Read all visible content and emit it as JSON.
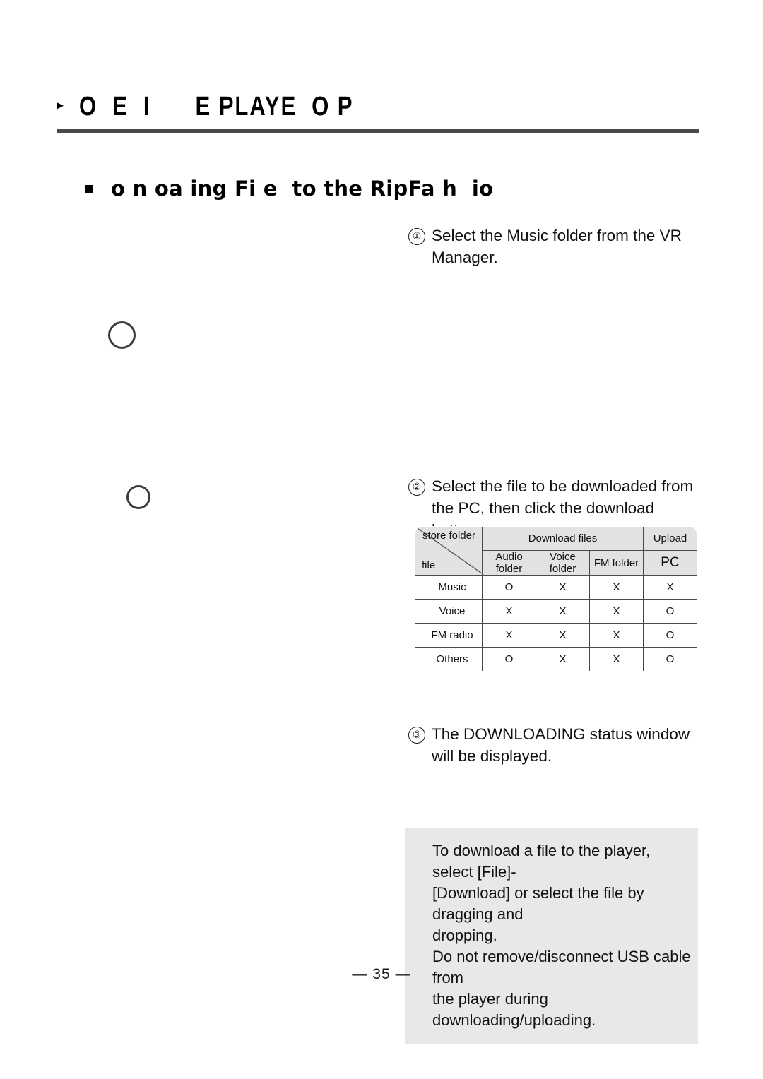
{
  "header": {
    "caret_icon": "triangle-right-icon",
    "title": "O  E  I      E PLAYE  O P"
  },
  "subtitle": {
    "bullet_icon": "square-bullet-icon",
    "text": "o n oa ing Fi e  to the RipFa h  io"
  },
  "steps": [
    {
      "number": "①",
      "text": "Select the Music folder from the VR Manager."
    },
    {
      "number": "②",
      "text": "Select the file to be downloaded from the PC, then click the download button."
    },
    {
      "number": "③",
      "text": "The DOWNLOADING status window will be displayed."
    }
  ],
  "table": {
    "corner": {
      "top_label": "store folder",
      "bottom_label": "file"
    },
    "group_headers": [
      {
        "label": "Download files",
        "span": 3
      },
      {
        "label": "Upload",
        "span": 1
      }
    ],
    "column_headers": [
      "Audio folder",
      "Voice folder",
      "FM folder",
      "PC"
    ],
    "rows": [
      {
        "label": "Music",
        "cells": [
          "O",
          "X",
          "X",
          "X"
        ]
      },
      {
        "label": "Voice",
        "cells": [
          "X",
          "X",
          "X",
          "O"
        ]
      },
      {
        "label": "FM radio",
        "cells": [
          "X",
          "X",
          "X",
          "O"
        ]
      },
      {
        "label": "Others",
        "cells": [
          "O",
          "X",
          "X",
          "O"
        ]
      }
    ]
  },
  "note": {
    "lines": [
      "To download a file to the player, select [File]-",
      "[Download] or select the file by dragging and",
      "dropping.",
      "Do not  remove/disconnect USB cable from",
      "the player during downloading/uploading."
    ]
  },
  "footer": {
    "page_number": "— 35 —"
  },
  "colors": {
    "rule": "#4a4a4a",
    "table_header_bg": "#e2e2e2",
    "note_bg": "#e8e8e8",
    "text": "#111111"
  }
}
